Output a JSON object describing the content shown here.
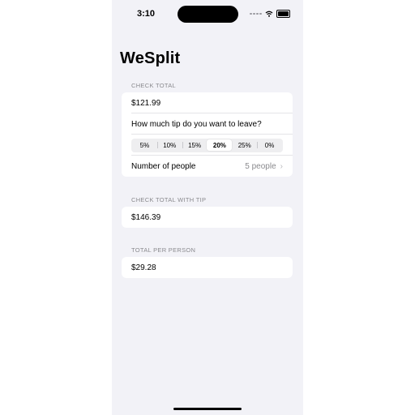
{
  "status_bar": {
    "time": "3:10"
  },
  "navigation": {
    "title": "WeSplit"
  },
  "check_section": {
    "header": "CHECK TOTAL",
    "amount": "$121.99",
    "tip_prompt": "How much tip do you want to leave?",
    "tip_options": [
      "5%",
      "10%",
      "15%",
      "20%",
      "25%",
      "0%"
    ],
    "selected_tip": "20%",
    "people_label": "Number of people",
    "people_value": "5 people"
  },
  "total_with_tip_section": {
    "header": "CHECK TOTAL WITH TIP",
    "value": "$146.39"
  },
  "per_person_section": {
    "header": "TOTAL PER PERSON",
    "value": "$29.28"
  },
  "icons": [
    "cellular-dots-icon",
    "wifi-icon",
    "battery-icon",
    "chevron-right-icon"
  ]
}
